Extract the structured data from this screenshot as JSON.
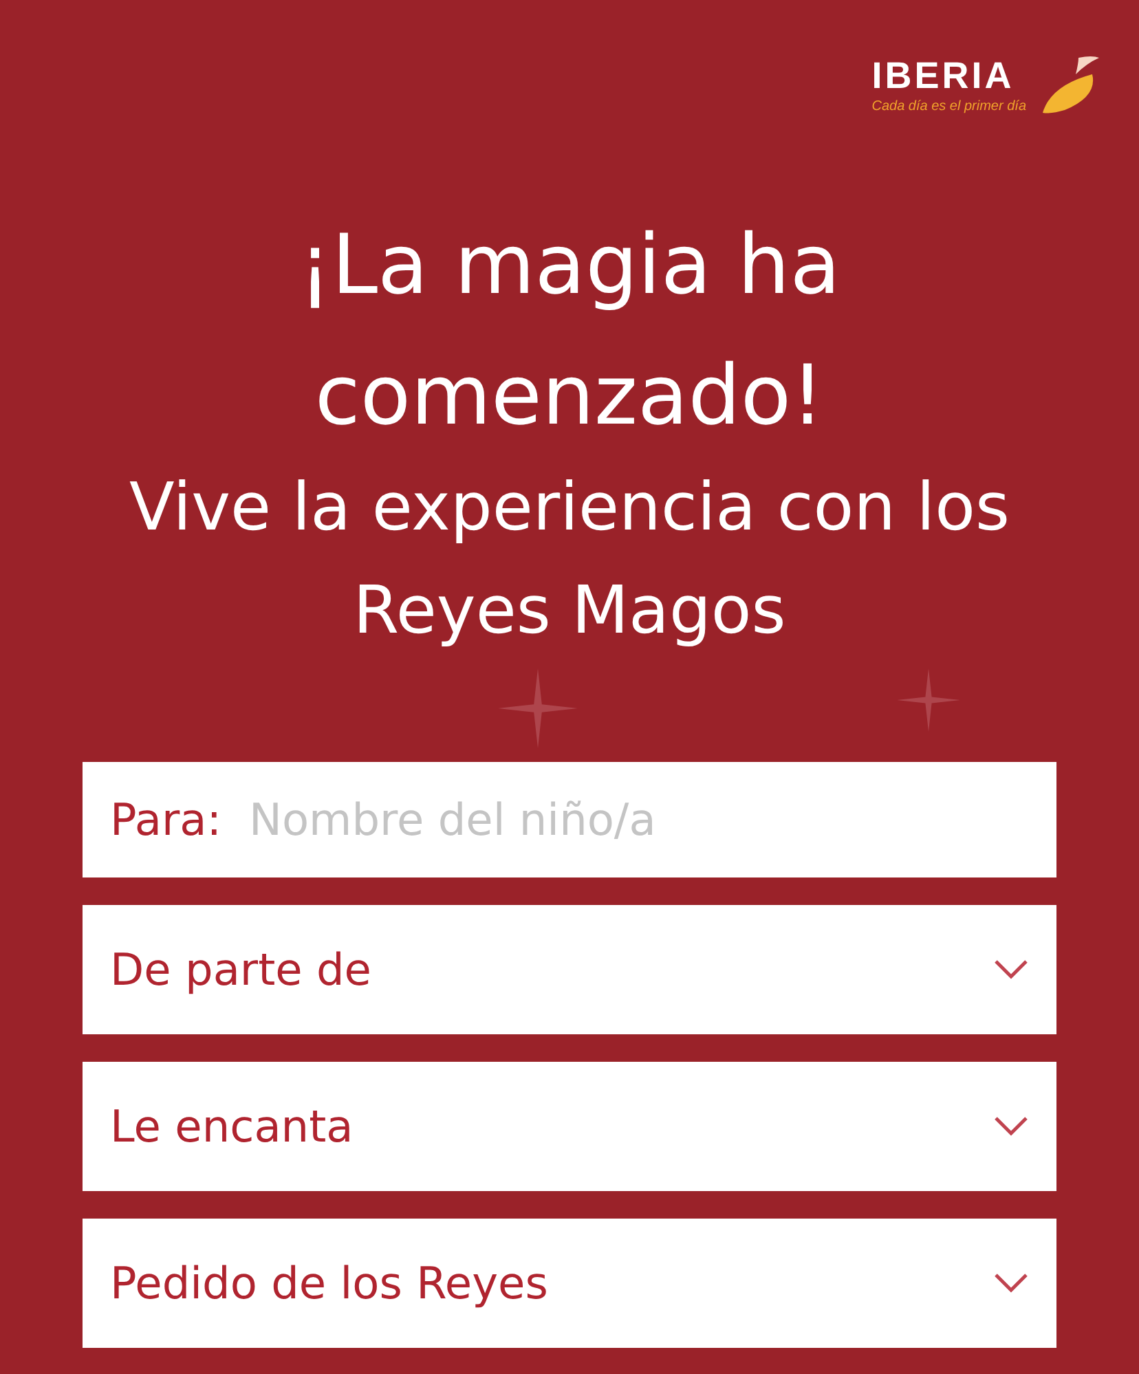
{
  "logo": {
    "name": "IBERIA",
    "tagline": "Cada día es el primer día"
  },
  "heading": "¡La magia ha comenzado!",
  "subheading": "Vive la experiencia con los Reyes Magos",
  "fields": [
    {
      "kind": "text",
      "label": "Para:",
      "placeholder": "Nombre del niño/a"
    },
    {
      "kind": "select",
      "value": "De parte de"
    },
    {
      "kind": "select",
      "value": "Le encanta"
    },
    {
      "kind": "select",
      "value": "Pedido de los Reyes"
    }
  ]
}
